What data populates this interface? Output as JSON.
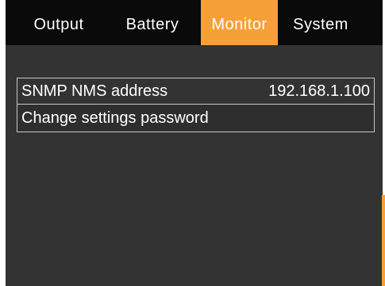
{
  "tabs": [
    {
      "label": "Output"
    },
    {
      "label": "Battery"
    },
    {
      "label": "Monitor"
    },
    {
      "label": "System"
    }
  ],
  "active_tab": "Monitor",
  "settings": [
    {
      "label": "SNMP NMS address",
      "value": "192.168.1.100"
    },
    {
      "label": "Change settings password"
    }
  ],
  "colors": {
    "accent": "#f6a03a",
    "background": "#333333",
    "tabbar": "#0a0a0a"
  }
}
